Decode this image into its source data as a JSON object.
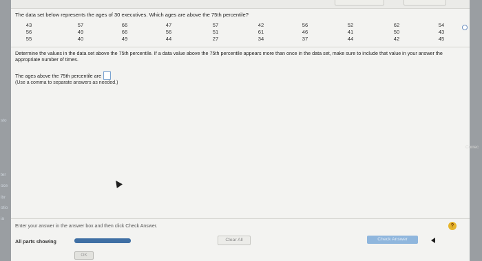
{
  "question": "The data set below represents the ages of 30 executives. Which ages are above the 75th percentile?",
  "data_rows": [
    [
      "43",
      "57",
      "66",
      "47",
      "57",
      "42",
      "56",
      "52",
      "62",
      "54"
    ],
    [
      "56",
      "49",
      "66",
      "56",
      "51",
      "61",
      "46",
      "41",
      "50",
      "43"
    ],
    [
      "55",
      "40",
      "49",
      "44",
      "27",
      "34",
      "37",
      "44",
      "42",
      "45"
    ]
  ],
  "instructions": "Determine the values in the data set above the 75th percentile. If a data value above the 75th percentile appears more than once in the data set, make sure to include that value in your answer the appropriate number of times.",
  "answer": {
    "label": "The ages above the 75th percentile are",
    "value": "",
    "hint": "(Use a comma to separate answers as needed.)"
  },
  "status_message": "Enter your answer in the answer box and then click Check Answer.",
  "parts_label": "All parts showing",
  "progress_fraction": 1.0,
  "buttons": {
    "clear_all": "Clear All",
    "check_answer": "Check Answer",
    "ok": "OK"
  },
  "side_labels": {
    "left": [
      "sto",
      "ter",
      "oce",
      "ibr",
      "otio",
      "ia"
    ],
    "right": "Correc"
  },
  "colors": {
    "accent": "#3f6fa4",
    "help_icon": "#e6b52c",
    "answer_box_border": "#7aa3d1"
  }
}
